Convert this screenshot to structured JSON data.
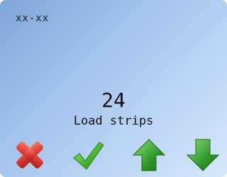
{
  "screen": {
    "header_code": "xx-xx",
    "value": "24",
    "label": "Load strips"
  },
  "buttons": {
    "cancel": {
      "icon": "cross-icon",
      "color": "#d9382f"
    },
    "confirm": {
      "icon": "checkmark-icon",
      "color": "#45b02b"
    },
    "up": {
      "icon": "arrow-up-icon",
      "color": "#2f9a2a"
    },
    "down": {
      "icon": "arrow-down-icon",
      "color": "#2f9a2a"
    }
  },
  "colors": {
    "background_start": "#7ea6d8",
    "background_end": "#d6e7fb",
    "text": "#111111"
  }
}
